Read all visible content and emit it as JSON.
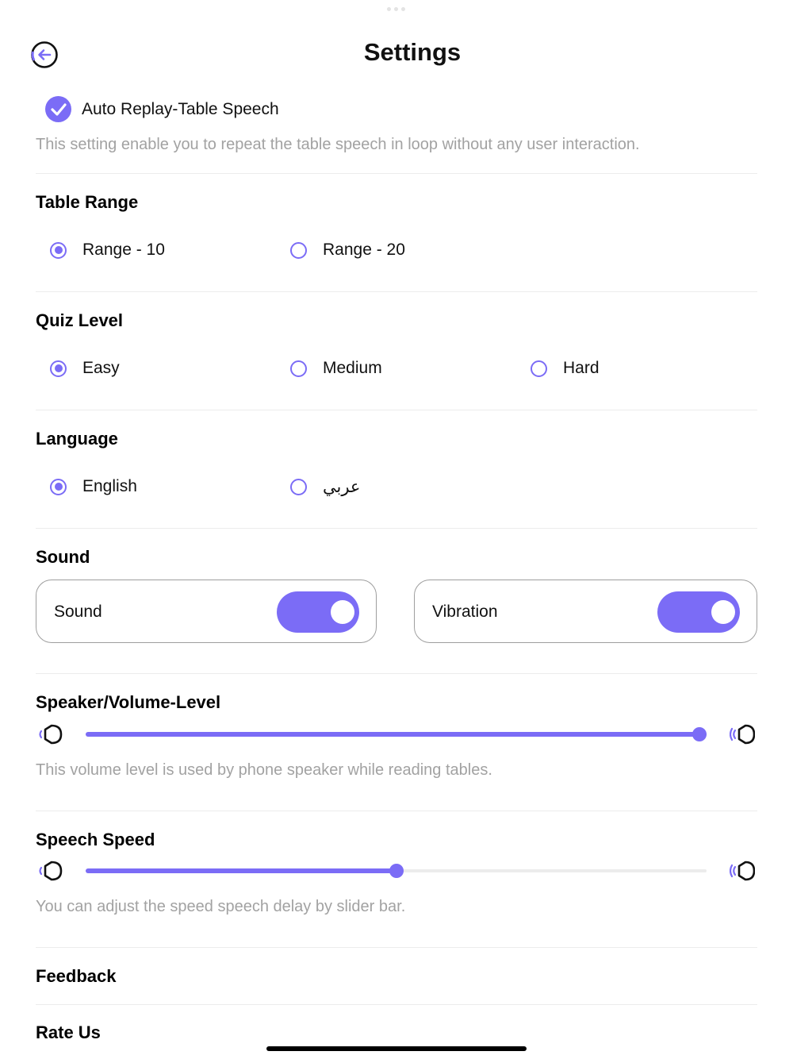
{
  "header": {
    "title": "Settings",
    "back_icon": "back-arrow-circle-icon"
  },
  "auto_replay": {
    "label": "Auto Replay-Table Speech",
    "checked": true,
    "description": "This setting enable you to repeat the table speech in  loop without any user interaction."
  },
  "table_range": {
    "title": "Table Range",
    "options": [
      "Range - 10",
      "Range - 20"
    ],
    "selected": "Range - 10"
  },
  "quiz_level": {
    "title": "Quiz Level",
    "options": [
      "Easy",
      "Medium",
      "Hard"
    ],
    "selected": "Easy"
  },
  "language": {
    "title": "Language",
    "options": [
      "English",
      "عربي"
    ],
    "selected": "English"
  },
  "sound": {
    "title": "Sound",
    "sound_label": "Sound",
    "sound_on": true,
    "vibration_label": "Vibration",
    "vibration_on": true
  },
  "volume": {
    "title": "Speaker/Volume-Level",
    "level": 1.0,
    "description": "This volume level is used by phone speaker while reading tables."
  },
  "speech_speed": {
    "title": "Speech Speed",
    "level": 0.5,
    "description": "You can adjust the speed speech delay by slider bar."
  },
  "links": {
    "feedback": "Feedback",
    "rate_us": "Rate Us"
  },
  "colors": {
    "accent": "#7b6cf6",
    "muted_text": "#a2a2a2",
    "divider": "#ececec"
  }
}
